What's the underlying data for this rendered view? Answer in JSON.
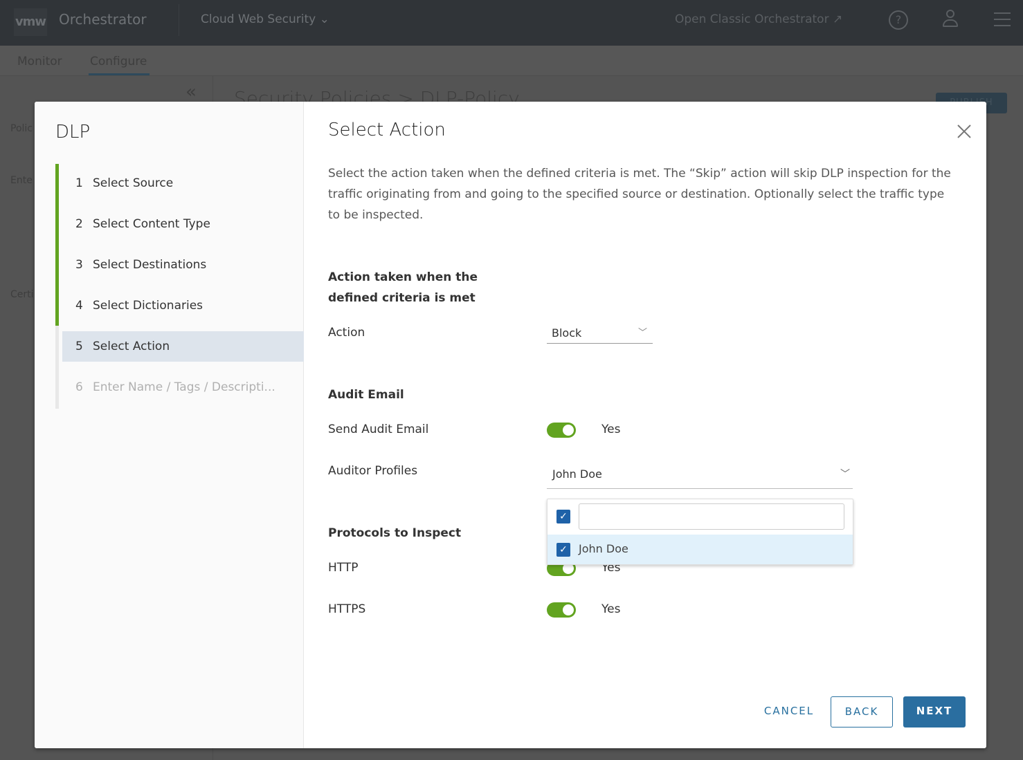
{
  "header": {
    "logo": "vmw",
    "app_name": "Orchestrator",
    "product": "Cloud Web Security",
    "classic_link": "Open Classic Orchestrator"
  },
  "nav": {
    "tabs": [
      {
        "label": "Monitor"
      },
      {
        "label": "Configure",
        "active": true
      }
    ]
  },
  "background": {
    "title": "Security Policies > DLP-Policy",
    "publish": "PUBLISH",
    "sidebar": [
      "Polic",
      "Ente",
      "Certi"
    ]
  },
  "modal": {
    "wizard_title": "DLP",
    "steps": [
      {
        "num": "1",
        "label": "Select Source",
        "state": "complete"
      },
      {
        "num": "2",
        "label": "Select Content Type",
        "state": "complete"
      },
      {
        "num": "3",
        "label": "Select Destinations",
        "state": "complete"
      },
      {
        "num": "4",
        "label": "Select Dictionaries",
        "state": "complete"
      },
      {
        "num": "5",
        "label": "Select Action",
        "state": "active"
      },
      {
        "num": "6",
        "label": "Enter Name / Tags / Descripti...",
        "state": "disabled"
      }
    ],
    "title": "Select Action",
    "description": "Select the action taken when the defined criteria is met. The “Skip” action will skip DLP inspection for the traffic originating from and going to the specified source or destination. Optionally select the traffic type to be inspected.",
    "action_section": "Action taken when the defined criteria is met",
    "action_label": "Action",
    "action_value": "Block",
    "audit_section": "Audit Email",
    "send_audit_label": "Send Audit Email",
    "send_audit_value": "Yes",
    "auditor_label": "Auditor Profiles",
    "auditor_value": "John Doe",
    "dropdown": {
      "search_value": "",
      "select_all_checked": true,
      "options": [
        {
          "label": "John Doe",
          "checked": true
        }
      ]
    },
    "protocols_section": "Protocols to Inspect",
    "http_label": "HTTP",
    "http_value": "Yes",
    "https_label": "HTTPS",
    "https_value": "Yes",
    "buttons": {
      "cancel": "CANCEL",
      "back": "BACK",
      "next": "NEXT"
    }
  },
  "colors": {
    "accent": "#2a6ea0",
    "toggle_on": "#62a420",
    "progress": "#62a420",
    "checkbox": "#1f62a8"
  }
}
